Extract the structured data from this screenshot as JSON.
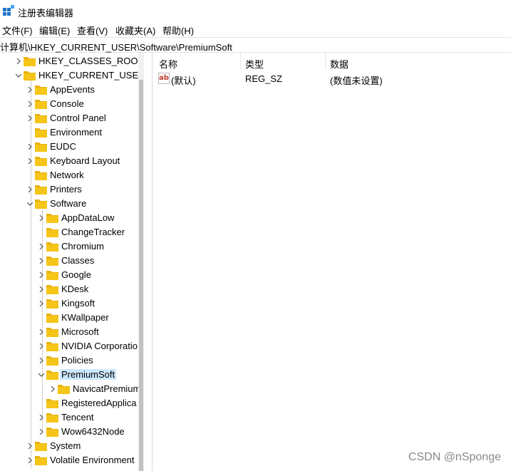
{
  "window": {
    "title": "注册表编辑器"
  },
  "menu": [
    "文件(F)",
    "编辑(E)",
    "查看(V)",
    "收藏夹(A)",
    "帮助(H)"
  ],
  "address": "计算机\\HKEY_CURRENT_USER\\Software\\PremiumSoft",
  "tree": {
    "hkcr": "HKEY_CLASSES_ROOT",
    "hkcu": "HKEY_CURRENT_USER",
    "hkcu_children": [
      "AppEvents",
      "Console",
      "Control Panel",
      "Environment",
      "EUDC",
      "Keyboard Layout",
      "Network",
      "Printers",
      "Software"
    ],
    "software_children": [
      "AppDataLow",
      "ChangeTracker",
      "Chromium",
      "Classes",
      "Google",
      "KDesk",
      "Kingsoft",
      "KWallpaper",
      "Microsoft",
      "NVIDIA Corporatio",
      "Policies",
      "PremiumSoft"
    ],
    "premiumsoft_children": [
      "NavicatPremium"
    ],
    "software_rest": [
      "RegisteredApplica",
      "Tencent",
      "Wow6432Node"
    ],
    "hkcu_rest": [
      "System",
      "Volatile Environment"
    ]
  },
  "list": {
    "columns": [
      "名称",
      "类型",
      "数据"
    ],
    "rows": [
      {
        "name": "(默认)",
        "type": "REG_SZ",
        "data": "(数值未设置)",
        "icon": "ab"
      }
    ]
  },
  "watermark": "CSDN @nSponge",
  "colors": {
    "folder": "#f5c518",
    "selected": "#cce8ff"
  }
}
